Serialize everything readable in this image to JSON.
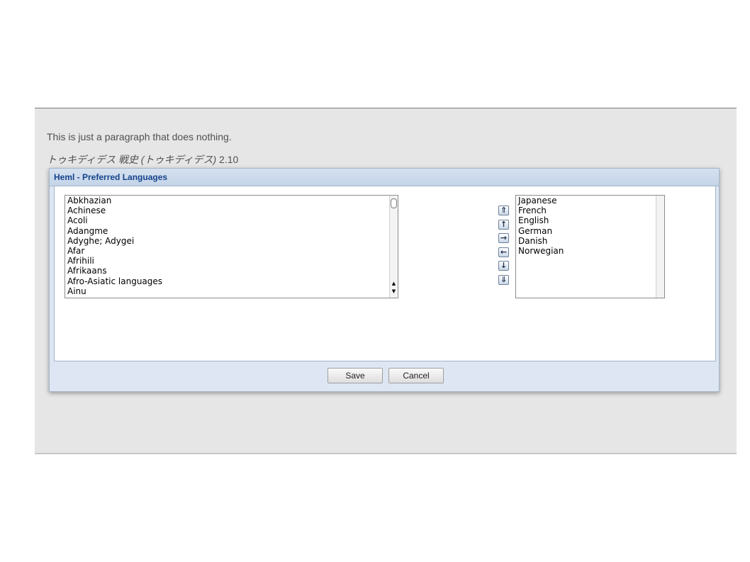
{
  "page": {
    "paragraph": "This is just a paragraph that does nothing.",
    "citation_author": "トゥキディデス",
    "citation_title": "戦史 (トゥキディデス)",
    "citation_ref": "2.10"
  },
  "dialog": {
    "title": "Heml - Preferred Languages",
    "available_languages": [
      "Abkhazian",
      "Achinese",
      "Acoli",
      "Adangme",
      "Adyghe; Adygei",
      "Afar",
      "Afrihili",
      "Afrikaans",
      "Afro-Asiatic languages",
      "Ainu"
    ],
    "preferred_languages": [
      "Japanese",
      "French",
      "English",
      "German",
      "Danish",
      "Norwegian"
    ],
    "move_buttons": [
      {
        "name": "move-top-button",
        "icon": "double-arrow-up-icon",
        "glyph": "⇑"
      },
      {
        "name": "move-up-button",
        "icon": "arrow-up-icon",
        "glyph": "↑"
      },
      {
        "name": "add-button",
        "icon": "arrow-right-icon",
        "glyph": "→"
      },
      {
        "name": "remove-button",
        "icon": "arrow-left-icon",
        "glyph": "←"
      },
      {
        "name": "move-down-button",
        "icon": "arrow-down-icon",
        "glyph": "↓"
      },
      {
        "name": "move-bottom-button",
        "icon": "double-arrow-down-icon",
        "glyph": "⇓"
      }
    ],
    "save_label": "Save",
    "cancel_label": "Cancel"
  },
  "colors": {
    "title_text": "#15428b",
    "dialog_frame": "#dde6f2",
    "page_background": "#e6e6e6"
  }
}
